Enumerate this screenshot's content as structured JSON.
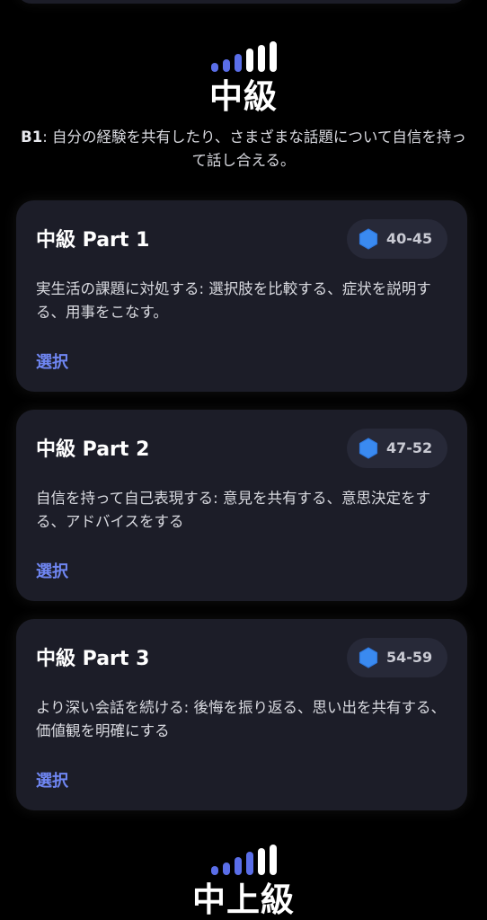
{
  "colors": {
    "background": "#000000",
    "card": "#1c1d28",
    "badge": "#272938",
    "accent_link": "#6f86f2",
    "signal_active": "#5a6ee8",
    "signal_inactive": "#ffffff",
    "hex_icon": "#3a8af0"
  },
  "sections": [
    {
      "title": "中級",
      "code": "B1",
      "description": ": 自分の経験を共有したり、さまざまな話題について自信を持って話し合える。",
      "signal_icon": "signal-strength-icon",
      "signal_level": 3,
      "cards": [
        {
          "title": "中級 Part 1",
          "badge_icon": "hexagon-icon",
          "badge_range": "40-45",
          "description": "実生活の課題に対処する: 選択肢を比較する、症状を説明する、用事をこなす。",
          "action_label": "選択"
        },
        {
          "title": "中級 Part 2",
          "badge_icon": "hexagon-icon",
          "badge_range": "47-52",
          "description": "自信を持って自己表現する: 意見を共有する、意思決定をする、アドバイスをする",
          "action_label": "選択"
        },
        {
          "title": "中級 Part 3",
          "badge_icon": "hexagon-icon",
          "badge_range": "54-59",
          "description": "より深い会話を続ける: 後悔を振り返る、思い出を共有する、価値観を明確にする",
          "action_label": "選択"
        }
      ]
    },
    {
      "title": "中上級",
      "signal_icon": "signal-strength-icon",
      "signal_level": 4
    }
  ]
}
